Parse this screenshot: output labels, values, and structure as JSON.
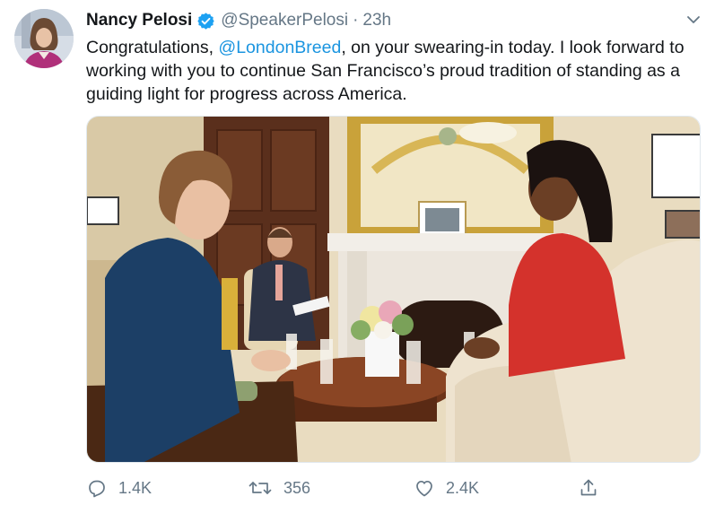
{
  "author": {
    "name": "Nancy Pelosi",
    "handle": "@SpeakerPelosi",
    "separator": "·",
    "time": "23h"
  },
  "tweet": {
    "text_before": "Congratulations, ",
    "mention": "@LondonBreed",
    "text_after": ", on your swearing-in today. I look forward to working with you to continue San Francisco’s proud tradition of standing as a guiding light for progress across America."
  },
  "actions": {
    "reply_count": "1.4K",
    "retweet_count": "356",
    "like_count": "2.4K"
  },
  "icons": {
    "verified": "verified-badge-icon",
    "caret": "chevron-down-icon",
    "reply": "reply-icon",
    "retweet": "retweet-icon",
    "like": "heart-icon",
    "share": "share-icon"
  },
  "colors": {
    "link": "#1b95e0",
    "verified": "#1da1f2",
    "muted": "#657786",
    "text": "#14171a"
  }
}
